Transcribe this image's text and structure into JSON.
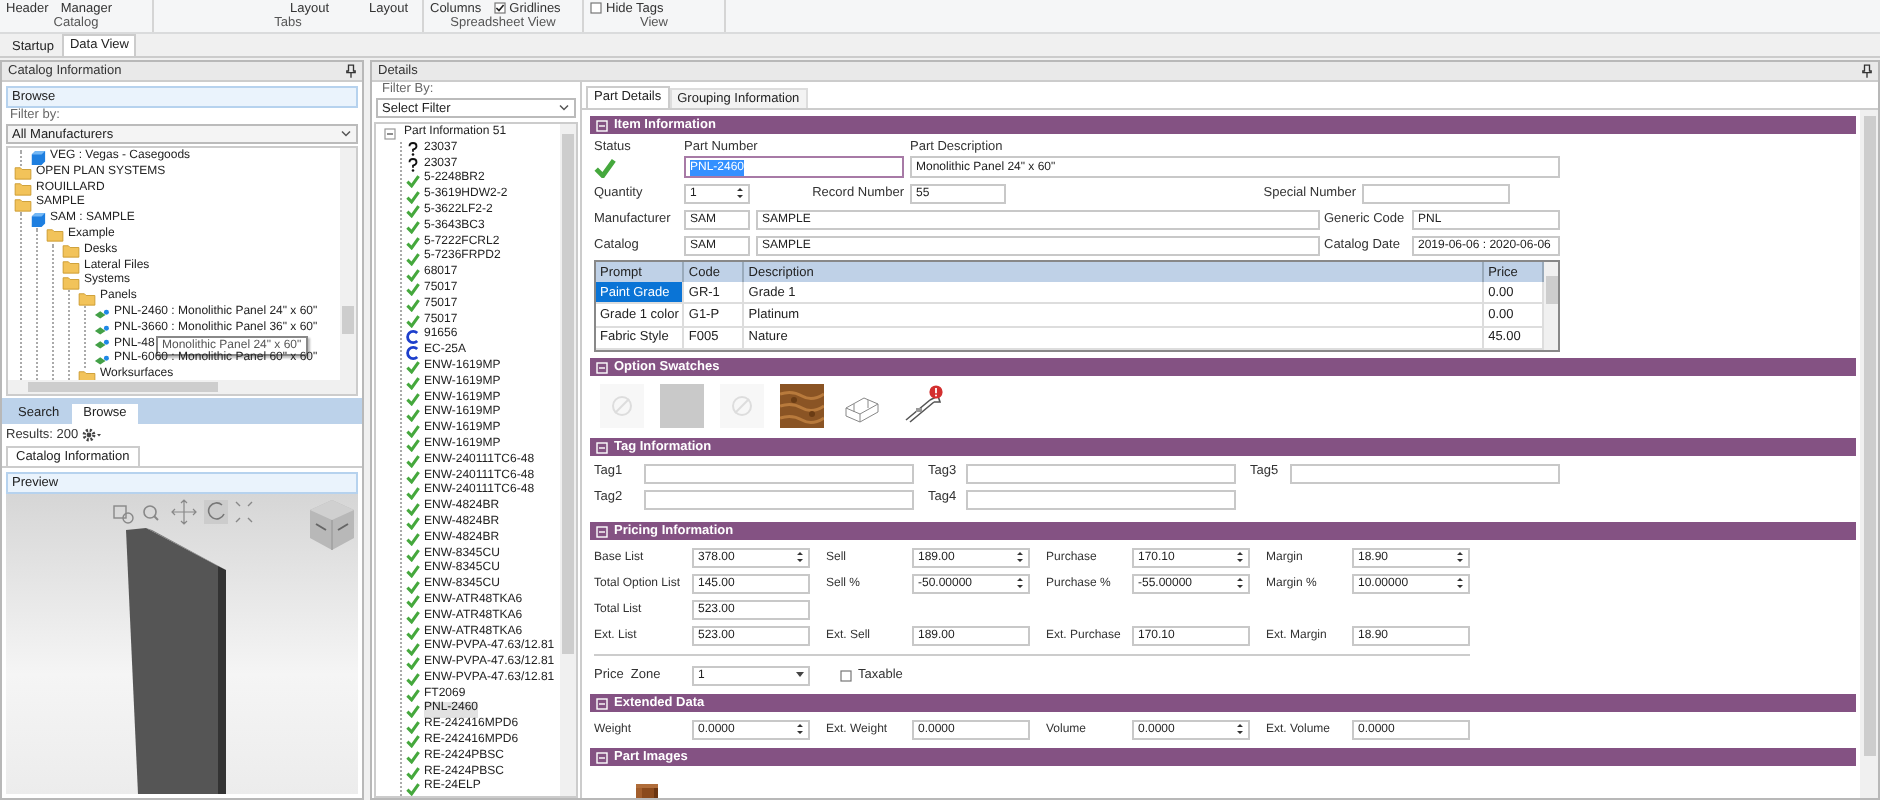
{
  "ribbon": {
    "groups": [
      {
        "label": "Catalog",
        "items": [
          {
            "kind": "button",
            "label": "Header"
          },
          {
            "kind": "button",
            "label": "Manager"
          }
        ]
      },
      {
        "label": "Tabs",
        "items": [
          {
            "kind": "button",
            "label": "Layout"
          },
          {
            "kind": "button",
            "label": "Layout"
          }
        ]
      },
      {
        "label": "Spreadsheet View",
        "items": [
          {
            "kind": "button",
            "label": "Columns"
          },
          {
            "kind": "checkbox",
            "label": "Gridlines",
            "checked": true
          }
        ]
      },
      {
        "label": "View",
        "items": [
          {
            "kind": "checkbox",
            "label": "Hide Tags",
            "checked": false
          }
        ]
      }
    ]
  },
  "doc_tabs": [
    {
      "label": "Startup",
      "selected": false
    },
    {
      "label": "Data View",
      "selected": true
    }
  ],
  "catalog_panel": {
    "title": "Catalog Information",
    "browse_title": "Browse",
    "filter_label": "Filter by:",
    "filter": "All Manufacturers",
    "tree": [
      {
        "children": [
          {
            "label": "VEG : Vegas - Casegoods",
            "kind": "catalog"
          }
        ]
      },
      {
        "label": "OPEN PLAN SYSTEMS",
        "kind": "folder"
      },
      {
        "label": "ROUILLARD",
        "kind": "folder"
      },
      {
        "label": "SAMPLE",
        "kind": "folder",
        "children": [
          {
            "label": "SAM : SAMPLE",
            "kind": "catalog",
            "children": [
              {
                "label": "Example",
                "kind": "folder",
                "children": [
                  {
                    "label": "Desks",
                    "kind": "folder"
                  },
                  {
                    "label": "Lateral Files",
                    "kind": "folder"
                  },
                  {
                    "label": "Systems",
                    "kind": "folder",
                    "children": [
                      {
                        "label": "Panels",
                        "kind": "folder",
                        "children": [
                          {
                            "label": "PNL-2460 : Monolithic Panel 24\" x 60\"",
                            "kind": "part"
                          },
                          {
                            "label": "PNL-3660 : Monolithic Panel 36\" x 60\"",
                            "kind": "part"
                          },
                          {
                            "label": "PNL-48",
                            "kind": "part",
                            "tooltip": "Monolithic Panel 24\" x 60\""
                          },
                          {
                            "label": "PNL-6060 : Monolithic Panel 60\" x 60\"",
                            "kind": "part"
                          }
                        ]
                      },
                      {
                        "label": "Worksurfaces",
                        "kind": "folder"
                      }
                    ]
                  }
                ]
              }
            ]
          }
        ]
      }
    ],
    "tabs": [
      {
        "label": "Search",
        "selected": false
      },
      {
        "label": "Browse",
        "selected": true
      }
    ],
    "results": "Results: 200",
    "info_tab": "Catalog Information",
    "preview_title": "Preview"
  },
  "details_panel": {
    "title": "Details",
    "filter_label": "Filter By:",
    "filter": "Select Filter",
    "parts": {
      "label": "Part Information 51",
      "expanded": true,
      "children": [
        {
          "label": "23037",
          "kind": "unknown",
          "selected": false
        },
        {
          "label": "23037",
          "kind": "unknown",
          "selected": false
        },
        {
          "label": "5-2248BR2",
          "kind": "valid",
          "selected": false
        },
        {
          "label": "5-3619HDW2-2",
          "kind": "valid",
          "selected": false
        },
        {
          "label": "5-3622LF2-2",
          "kind": "valid",
          "selected": false
        },
        {
          "label": "5-3643BC3",
          "kind": "valid",
          "selected": false
        },
        {
          "label": "5-7222FCRL2",
          "kind": "valid",
          "selected": false
        },
        {
          "label": "5-7236FRPD2",
          "kind": "valid",
          "selected": false
        },
        {
          "label": "68017",
          "kind": "valid",
          "selected": false
        },
        {
          "label": "75017",
          "kind": "valid",
          "selected": false
        },
        {
          "label": "75017",
          "kind": "valid",
          "selected": false
        },
        {
          "label": "75017",
          "kind": "valid",
          "selected": false
        },
        {
          "label": "91656",
          "kind": "custom",
          "selected": false
        },
        {
          "label": "EC-25A",
          "kind": "custom",
          "selected": false
        },
        {
          "label": "ENW-1619MP",
          "kind": "valid",
          "selected": false
        },
        {
          "label": "ENW-1619MP",
          "kind": "valid",
          "selected": false
        },
        {
          "label": "ENW-1619MP",
          "kind": "valid",
          "selected": false
        },
        {
          "label": "ENW-1619MP",
          "kind": "valid",
          "selected": false
        },
        {
          "label": "ENW-1619MP",
          "kind": "valid",
          "selected": false
        },
        {
          "label": "ENW-1619MP",
          "kind": "valid",
          "selected": false
        },
        {
          "label": "ENW-240111TC6-48",
          "kind": "valid",
          "selected": false
        },
        {
          "label": "ENW-240111TC6-48",
          "kind": "valid",
          "selected": false
        },
        {
          "label": "ENW-240111TC6-48",
          "kind": "valid",
          "selected": false
        },
        {
          "label": "ENW-4824BR",
          "kind": "valid",
          "selected": false
        },
        {
          "label": "ENW-4824BR",
          "kind": "valid",
          "selected": false
        },
        {
          "label": "ENW-4824BR",
          "kind": "valid",
          "selected": false
        },
        {
          "label": "ENW-8345CU",
          "kind": "valid",
          "selected": false
        },
        {
          "label": "ENW-8345CU",
          "kind": "valid",
          "selected": false
        },
        {
          "label": "ENW-8345CU",
          "kind": "valid",
          "selected": false
        },
        {
          "label": "ENW-ATR48TKA6",
          "kind": "valid",
          "selected": false
        },
        {
          "label": "ENW-ATR48TKA6",
          "kind": "valid",
          "selected": false
        },
        {
          "label": "ENW-ATR48TKA6",
          "kind": "valid",
          "selected": false
        },
        {
          "label": "ENW-PVPA-47.63/12.81",
          "kind": "valid",
          "selected": false
        },
        {
          "label": "ENW-PVPA-47.63/12.81",
          "kind": "valid",
          "selected": false
        },
        {
          "label": "ENW-PVPA-47.63/12.81",
          "kind": "valid",
          "selected": false
        },
        {
          "label": "FT2069",
          "kind": "valid",
          "selected": false
        },
        {
          "label": "PNL-2460",
          "kind": "valid",
          "selected": true
        },
        {
          "label": "RE-242416MPD6",
          "kind": "valid",
          "selected": false
        },
        {
          "label": "RE-242416MPD6",
          "kind": "valid",
          "selected": false
        },
        {
          "label": "RE-2424PBSC",
          "kind": "valid",
          "selected": false
        },
        {
          "label": "RE-2424PBSC",
          "kind": "valid",
          "selected": false
        },
        {
          "label": "RE-24ELP",
          "kind": "valid",
          "selected": false
        }
      ]
    }
  },
  "tabs": [
    {
      "label": "Part Details",
      "selected": true
    },
    {
      "label": "Grouping Information",
      "selected": false
    }
  ],
  "item_information": {
    "title": "Item Information",
    "expanded": true,
    "status": {
      "label": "Status",
      "kind": "valid"
    },
    "part_number": {
      "label": "Part Number",
      "value": "PNL-2460",
      "focused": true
    },
    "part_description": {
      "label": "Part Description",
      "value": "Monolithic Panel 24\" x 60\""
    },
    "quantity": {
      "label": "Quantity",
      "value": "1"
    },
    "record_number": {
      "label": "Record Number",
      "value": "55"
    },
    "special_number": {
      "label": "Special Number"
    },
    "manufacturer": {
      "label": "Manufacturer",
      "code": "SAM",
      "name": "SAMPLE"
    },
    "generic_code": {
      "label": "Generic Code",
      "value": "PNL"
    },
    "catalog": {
      "label": "Catalog",
      "code": "SAM",
      "name": "SAMPLE"
    },
    "catalog_date": {
      "label": "Catalog Date",
      "value": "2019-06-06 : 2020-06-06"
    },
    "options_table": {
      "columns": [
        "Prompt",
        "Code",
        "Description",
        "Price"
      ],
      "rows": [
        {
          "cells": [
            "Paint Grade",
            "GR-1",
            "Grade 1",
            "0.00"
          ],
          "selected": true
        },
        {
          "cells": [
            "Grade 1 color",
            "G1-P",
            "Platinum",
            "0.00"
          ],
          "selected": false
        },
        {
          "cells": [
            "Fabric Style",
            "F005",
            "Nature",
            "45.00"
          ],
          "selected": false
        }
      ]
    }
  },
  "option_swatches": {
    "title": "Option Swatches",
    "expanded": true,
    "swatches": [
      {
        "kind": "blank",
        "warning": false
      },
      {
        "kind": "plain",
        "warning": false
      },
      {
        "kind": "blank",
        "warning": false
      },
      {
        "kind": "wood",
        "warning": false
      },
      {
        "kind": "wire",
        "warning": false
      },
      {
        "kind": "tool",
        "warning": true
      }
    ]
  },
  "tag_information": {
    "title": "Tag Information",
    "expanded": true,
    "tags": [
      {
        "label": "Tag1"
      },
      {
        "label": "Tag3"
      },
      {
        "label": "Tag5"
      },
      {
        "label": "Tag2"
      },
      {
        "label": "Tag4"
      }
    ]
  },
  "pricing_information": {
    "title": "Pricing Information",
    "expanded": true,
    "rows": [
      [
        {
          "label": "Base List",
          "value": "378.00",
          "kind": "spinner"
        },
        {
          "label": "Sell",
          "value": "189.00",
          "kind": "spinner"
        },
        {
          "label": "Purchase",
          "value": "170.10",
          "kind": "spinner"
        },
        {
          "label": "Margin",
          "value": "18.90",
          "kind": "spinner"
        }
      ],
      [
        {
          "label": "Total Option List",
          "value": "145.00",
          "kind": "text"
        },
        {
          "label": "Sell %",
          "value": "-50.00000",
          "kind": "spinner"
        },
        {
          "label": "Purchase %",
          "value": "-55.00000",
          "kind": "spinner"
        },
        {
          "label": "Margin %",
          "value": "10.00000",
          "kind": "spinner"
        }
      ],
      [
        {
          "label": "Total List",
          "value": "523.00",
          "kind": "text"
        }
      ],
      [
        {
          "label": "Ext. List",
          "value": "523.00",
          "kind": "text"
        },
        {
          "label": "Ext. Sell",
          "value": "189.00",
          "kind": "text"
        },
        {
          "label": "Ext. Purchase",
          "value": "170.10",
          "kind": "text"
        },
        {
          "label": "Ext. Margin",
          "value": "18.90",
          "kind": "text"
        }
      ]
    ],
    "price_zone": {
      "label": "Price  Zone",
      "value": "1"
    },
    "taxable": {
      "label": "Taxable",
      "checked": false
    }
  },
  "extended_data": {
    "title": "Extended Data",
    "expanded": true,
    "rows": [
      [
        {
          "label": "Weight",
          "value": "0.0000",
          "kind": "spinner"
        },
        {
          "label": "Ext. Weight",
          "value": "0.0000",
          "kind": "text"
        },
        {
          "label": "Volume",
          "value": "0.0000",
          "kind": "spinner"
        },
        {
          "label": "Ext. Volume",
          "value": "0.0000",
          "kind": "text"
        }
      ]
    ]
  },
  "part_images": {
    "title": "Part Images",
    "expanded": true
  }
}
